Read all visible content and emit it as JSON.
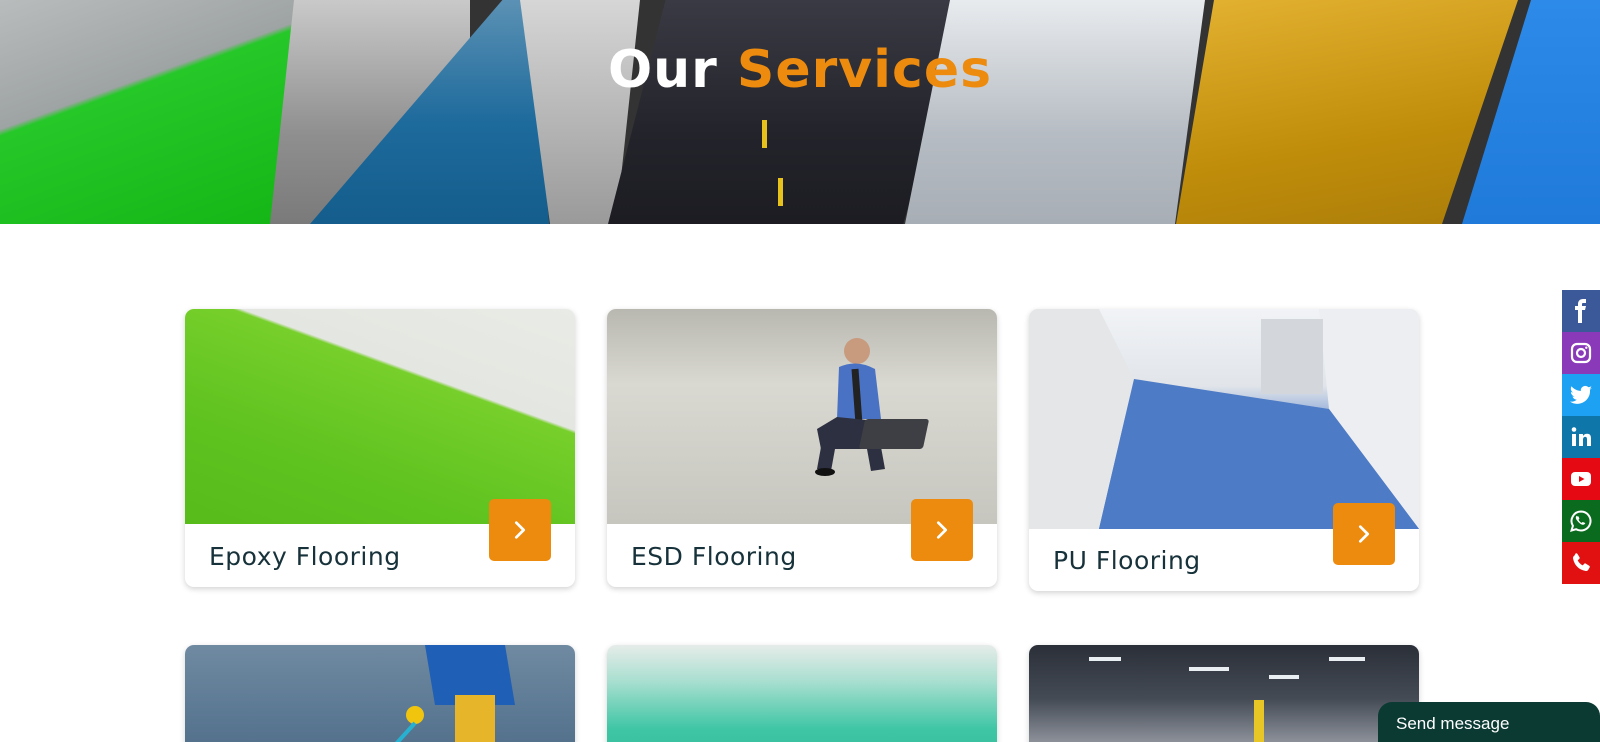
{
  "hero": {
    "title_white": "Our",
    "title_orange": "Services"
  },
  "services": [
    {
      "title": "Epoxy Flooring"
    },
    {
      "title": "ESD Flooring"
    },
    {
      "title": "PU Flooring"
    }
  ],
  "social": [
    {
      "name": "facebook-icon",
      "color": "#3b5998"
    },
    {
      "name": "instagram-icon",
      "color": "#8a3ab9"
    },
    {
      "name": "twitter-icon",
      "color": "#1da1f2"
    },
    {
      "name": "linkedin-icon",
      "color": "#0e76a8"
    },
    {
      "name": "youtube-icon",
      "color": "#e50914"
    },
    {
      "name": "whatsapp-icon",
      "color": "#0a6b1f"
    },
    {
      "name": "phone-icon",
      "color": "#e11111"
    }
  ],
  "chat": {
    "label": "Send message"
  },
  "colors": {
    "accent": "#ec8b0e",
    "chat_bg": "#0b3a33",
    "title_text": "#17323a"
  }
}
